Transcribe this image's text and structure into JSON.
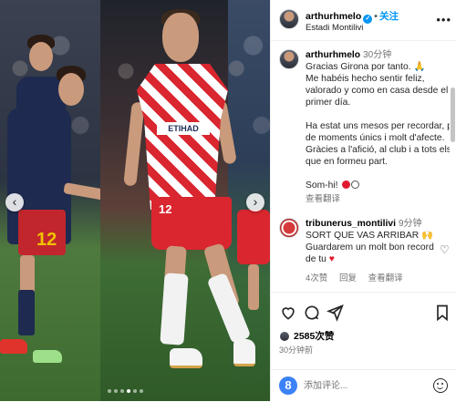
{
  "header": {
    "username": "arthurhmelo",
    "follow_label": "关注",
    "location": "Estadi Montilivi"
  },
  "media": {
    "shirt_number_left": "12",
    "sponsor_text": "ETIHAD",
    "shorts_number": "12",
    "slide_count": 6,
    "active_slide": 3
  },
  "caption": {
    "username": "arthurhmelo",
    "time": "30分钟",
    "lines_es": [
      "Gracias Girona por tanto. 🙏",
      "Me habéis hecho sentir feliz,",
      "valorado y como en casa desde el",
      "primer día."
    ],
    "lines_ca": [
      "Ha estat uns mesos per recordar, ple",
      "de moments únics i molt d'afecte.",
      "Gràcies a l'afició, al club i a tots els",
      "que en formeu part."
    ],
    "closing": "Som-hi!",
    "see_translation": "查看翻译"
  },
  "comment": {
    "username": "tribunerus_montilivi",
    "time": "9分钟",
    "lines": [
      "SORT QUE VAS ARRIBAR 🙌",
      "Guardarem un molt bon record",
      "de tu"
    ],
    "likes": "4次赞",
    "reply": "回复",
    "see_translation": "查看翻译"
  },
  "actions": {
    "likes": "2585次赞",
    "time": "30分钟前"
  },
  "comment_box": {
    "placeholder": "添加评论..."
  },
  "colors": {
    "accent_blue": "#0095f6",
    "girona_red": "#d9262f",
    "verified": "#0095f6"
  },
  "icons": [
    "verified-icon",
    "more-icon",
    "prev-arrow-icon",
    "next-arrow-icon",
    "heart-icon",
    "comment-icon",
    "share-icon",
    "bookmark-icon",
    "emoji-icon"
  ]
}
